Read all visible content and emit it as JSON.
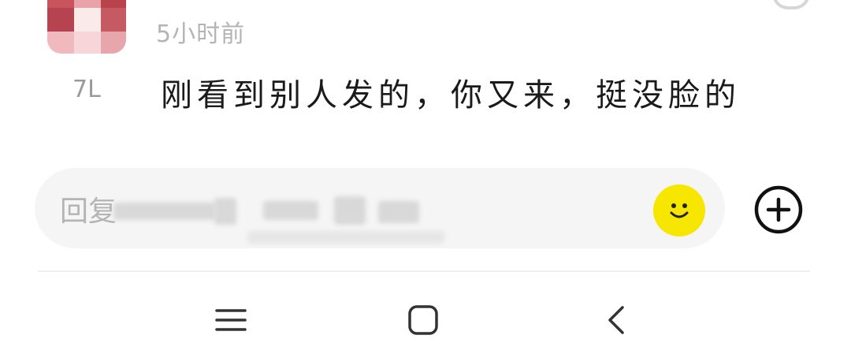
{
  "comment": {
    "timestamp": "5小时前",
    "floor": "7L",
    "text": "刚看到别人发的，你又来，挺没脸的"
  },
  "reply_bar": {
    "placeholder": "回复"
  },
  "icons": {
    "emoji": "smiley-face-icon",
    "plus": "plus-circle-icon",
    "nav_menu": "menu-lines-icon",
    "nav_home": "home-square-icon",
    "nav_back": "back-chevron-icon"
  },
  "colors": {
    "emoji_button_bg": "#f7e600",
    "reply_box_bg": "#f5f5f5",
    "timestamp_text": "#b4b4b4"
  }
}
